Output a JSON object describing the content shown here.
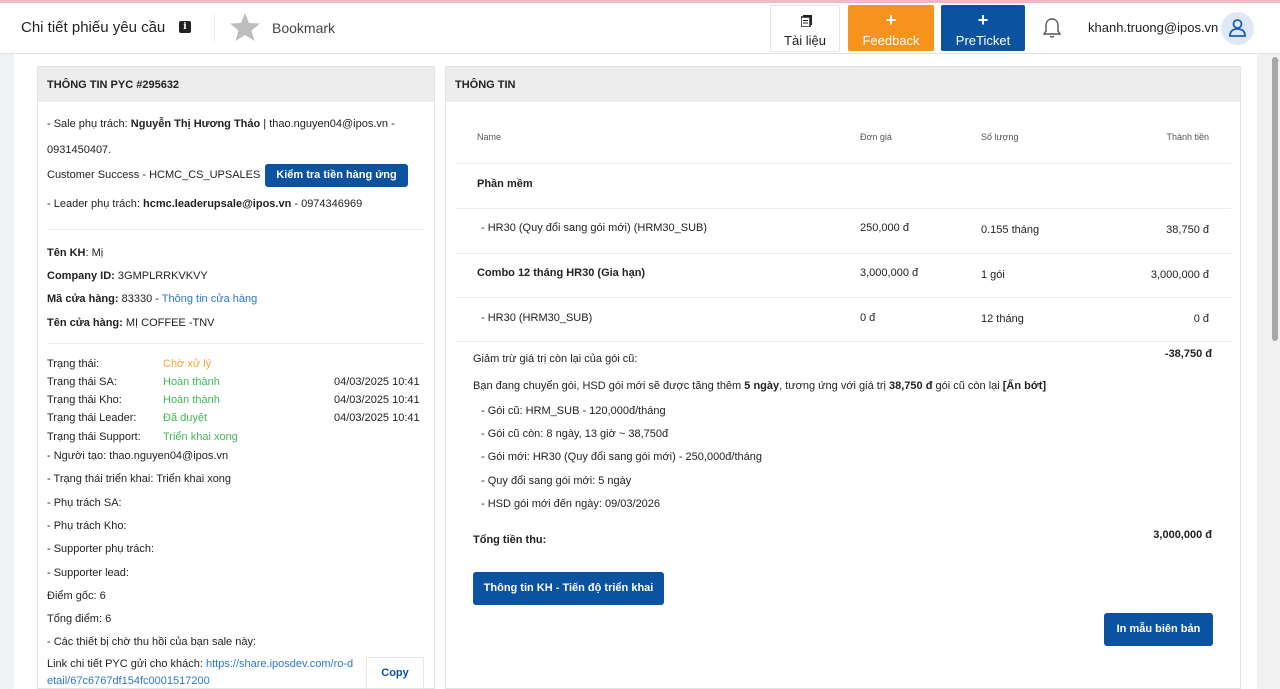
{
  "header": {
    "page_title": "Chi tiết phiếu yêu cầu",
    "bookmark": "Bookmark",
    "docs_label": "Tài liệu",
    "feedback_label": "Feedback",
    "preticket_label": "PreTicket",
    "plus": "+",
    "user_email": "khanh.truong@ipos.vn",
    "accent_orange": "#f7931d",
    "accent_blue": "#0b52a0"
  },
  "left": {
    "title": "THÔNG TIN PYC #295632",
    "sale_prefix": "- Sale phụ trách: ",
    "sale_name": "Nguyễn Thị Hương Thảo",
    "sale_contact": " | thao.nguyen04@ipos.vn -",
    "sale_phone": "0931450407.",
    "cs_text": "Customer Success - HCMC_CS_UPSALES",
    "check_button": "Kiểm tra tiền hàng ứng",
    "leader_prefix": "- Leader phụ trách: ",
    "leader_email": "hcmc.leaderupsale@ipos.vn",
    "leader_phone": " - 0974346969",
    "kh_label": "Tên KH",
    "kh_value": ": Mị",
    "company_label": "Company ID:",
    "company_value": " 3GMPLRRKVKVY",
    "store_code_label": "Mã cửa hàng:",
    "store_code_value": " 83330 - ",
    "store_info_link": "Thông tin cửa hàng",
    "store_name_label": "Tên cửa hàng:",
    "store_name_value": " MỊ COFFEE -TNV",
    "statuses": [
      {
        "label": "Trạng thái:",
        "value": "Chờ xử lý",
        "time": ""
      },
      {
        "label": "Trạng thái SA:",
        "value": "Hoàn thành",
        "time": "04/03/2025 10:41"
      },
      {
        "label": "Trạng thái Kho:",
        "value": "Hoàn thành",
        "time": "04/03/2025 10:41"
      },
      {
        "label": "Trạng thái Leader:",
        "value": "Đã duyệt",
        "time": "04/03/2025 10:41"
      },
      {
        "label": "Trạng thái Support:",
        "value": "Triển khai xong",
        "time": ""
      }
    ],
    "lines": [
      "- Người tạo: thao.nguyen04@ipos.vn",
      "- Trạng thái triển khai: Triển khai xong",
      "- Phụ trách SA:",
      "- Phụ trách Kho:",
      "- Supporter phụ trách:",
      "- Supporter lead:",
      "Điểm gốc: 6",
      "Tổng điểm: 6",
      "- Các thiết bị chờ thu hồi của bạn sale này:"
    ],
    "link_label": "Link chi tiết PYC gửi cho khách: ",
    "link_part1": "https://share.iposdev.com/ro-d",
    "link_part2": "etail/67c6767df154fc0001517200",
    "copy_button": "Copy"
  },
  "right": {
    "title": "THÔNG TIN",
    "columns": [
      "Name",
      "Đơn giá",
      "Số lượng",
      "Thành tiền"
    ],
    "section": "Phần mềm",
    "rows": [
      {
        "name": "- HR30 (Quy đổi sang gói mới) (HRM30_SUB)",
        "price": "250,000 đ",
        "qty": "0.155 tháng",
        "total": "38,750 đ",
        "bold": false
      },
      {
        "name": "Combo 12 tháng HR30 (Gia hạn)",
        "price": "3,000,000 đ",
        "qty": "1 gói",
        "total": "3,000,000 đ",
        "bold": true
      },
      {
        "name": "- HR30 (HRM30_SUB)",
        "price": "0 đ",
        "qty": "12 tháng",
        "total": "0 đ",
        "bold": false
      }
    ],
    "deduct_label": "Giảm trừ giá trị còn lại của gói cũ:",
    "deduct_value": "-38,750 đ",
    "switch_a": "Bạn đang chuyển gói, HSD gói mới sẽ được tăng thêm ",
    "switch_days": "5 ngày",
    "switch_b": ", tương ứng với giá trị ",
    "switch_value": "38,750 đ",
    "switch_c": " gói cũ còn lại ",
    "switch_toggle": "[Ẩn bớt]",
    "details": [
      "- Gói cũ: HRM_SUB - 120,000đ/tháng",
      "- Gói cũ còn: 8 ngày, 13 giờ ~ 38,750đ",
      "- Gói mới: HR30 (Quy đổi sang gói mới) - 250,000đ/tháng",
      "- Quy đổi sang gói mới: 5 ngày",
      "- HSD gói mới đến ngày: 09/03/2026"
    ],
    "total_label": "Tổng tiền thu:",
    "total_value": "3,000,000 đ",
    "btn_progress": "Thông tin KH - Tiến độ triển khai",
    "btn_print": "In mẫu biên bản"
  }
}
